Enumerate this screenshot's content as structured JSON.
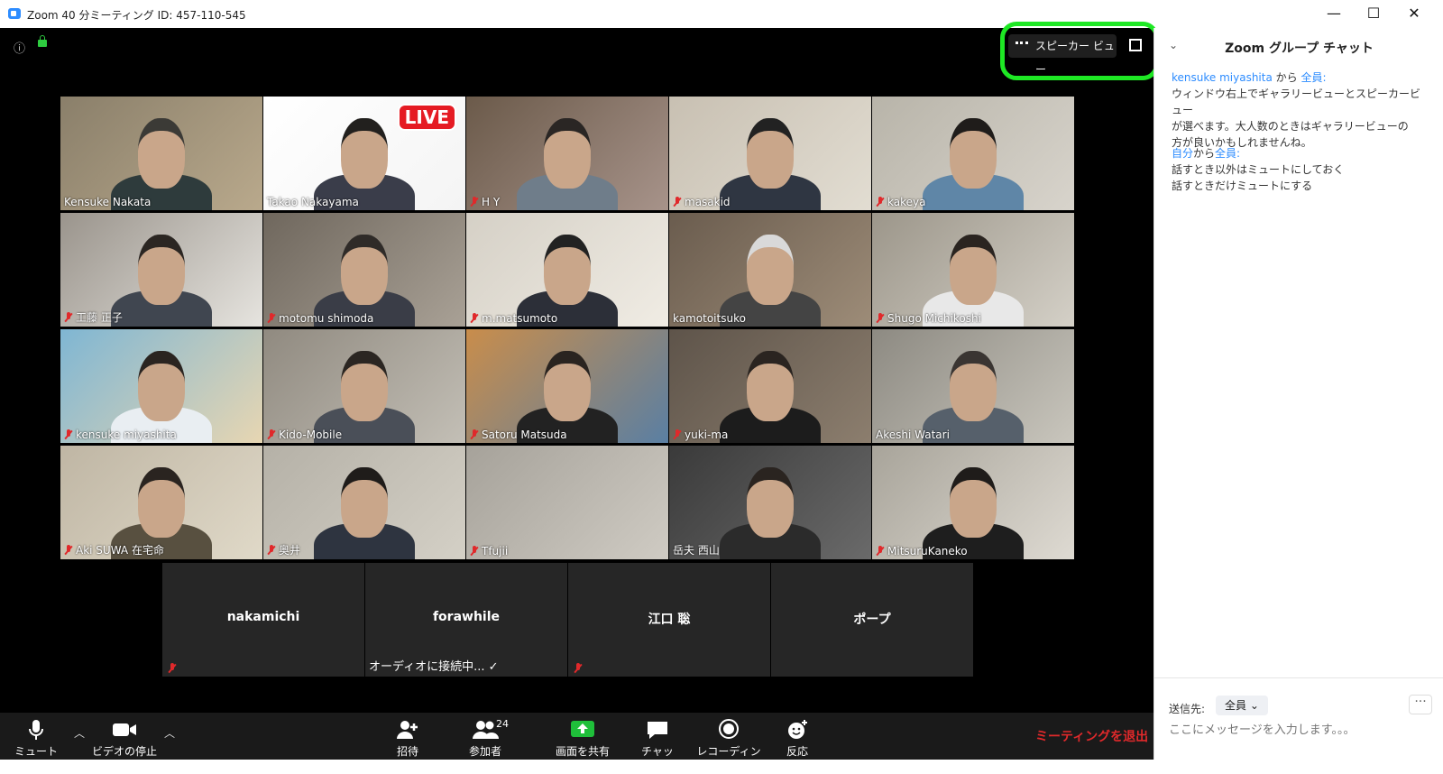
{
  "window": {
    "title": "Zoom 40 分ミーティング ID: 457-110-545",
    "minimize": "—",
    "maximize": "☐",
    "close": "✕"
  },
  "meeting": {
    "view_button": "スピーカー ビュー",
    "highlight_color": "#1ee824",
    "participants": [
      {
        "name": "Kensuke Nakata",
        "muted": false,
        "active": true
      },
      {
        "name": "Takao Nakayama",
        "muted": false,
        "live_badge": "LIVE"
      },
      {
        "name": "H Y",
        "muted": true
      },
      {
        "name": "masakid",
        "muted": true
      },
      {
        "name": "kakeya",
        "muted": true
      },
      {
        "name": "工藤 正子",
        "muted": true
      },
      {
        "name": "motomu shimoda",
        "muted": true
      },
      {
        "name": "m.matsumoto",
        "muted": true
      },
      {
        "name": "kamotoitsuko",
        "muted": false
      },
      {
        "name": "Shugo Michikoshi",
        "muted": true
      },
      {
        "name": "kensuke miyashita",
        "muted": true
      },
      {
        "name": "Kido-Mobile",
        "muted": true
      },
      {
        "name": "Satoru Matsuda",
        "muted": true
      },
      {
        "name": "yuki-ma",
        "muted": true
      },
      {
        "name": "Akeshi Watari",
        "muted": false
      },
      {
        "name": "Aki SUWA 在宅命",
        "muted": true
      },
      {
        "name": "奥井",
        "muted": true
      },
      {
        "name": "Tfujii",
        "muted": true
      },
      {
        "name": "岳夫 西山",
        "muted": false
      },
      {
        "name": "MitsuruKaneko",
        "muted": true
      }
    ],
    "no_video": [
      {
        "name": "nakamichi",
        "status": "",
        "muted": true
      },
      {
        "name": "forawhile",
        "status": "オーディオに接続中... ✓",
        "muted": false
      },
      {
        "name": "江口 聡",
        "status": "",
        "muted": true
      },
      {
        "name": "ポープ",
        "status": "",
        "muted": false
      }
    ]
  },
  "toolbar": {
    "mute": "ミュート",
    "video": "ビデオの停止",
    "invite": "招待",
    "participants": "参加者",
    "participant_count": "24",
    "share": "画面を共有",
    "chat": "チャット",
    "record": "レコーディング",
    "reactions": "反応",
    "leave": "ミーティングを退出"
  },
  "chat": {
    "title": "Zoom グループ チャット",
    "messages": [
      {
        "sender": "kensuke miyashita",
        "connector": " から ",
        "to": "全員",
        "colon": ":",
        "lines": [
          "ウィンドウ右上でギャラリービューとスピーカービュー",
          "が選べます。大人数のときはギャラリービューの",
          "方が良いかもしれませんね。"
        ]
      },
      {
        "sender": "自分",
        "connector": "から",
        "to": "全員",
        "colon": ":",
        "lines": [
          "話すとき以外はミュートにしておく",
          "話すときだけミュートにする"
        ]
      }
    ],
    "send_to_label": "送信先:",
    "send_to_value": "全員 ⌄",
    "more": "···",
    "input_placeholder": "ここにメッセージを入力します。。。"
  }
}
